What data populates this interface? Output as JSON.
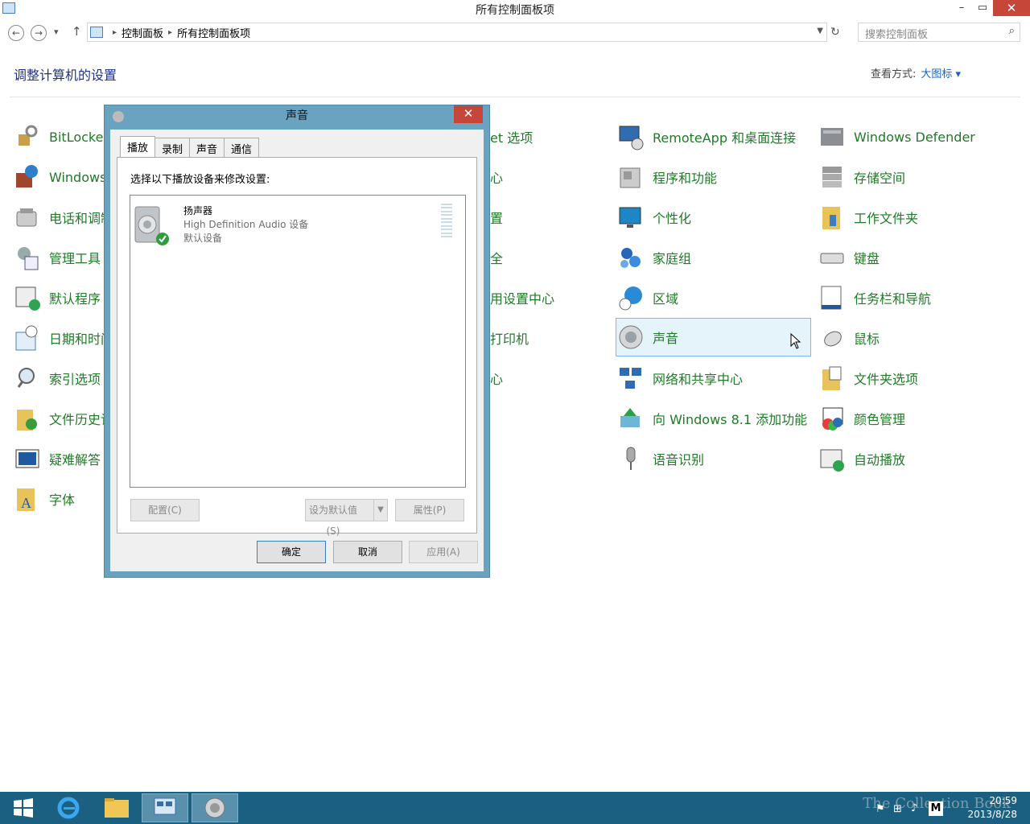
{
  "window": {
    "title": "所有控制面板项",
    "minimize": "–",
    "maximize": "▭",
    "close": "✕"
  },
  "nav": {
    "back": "←",
    "forward": "→",
    "recent": "▾",
    "up": "↑",
    "breadcrumb": [
      "控制面板",
      "所有控制面板项"
    ],
    "refresh": "↻",
    "search_placeholder": "搜索控制面板"
  },
  "header": {
    "title": "调整计算机的设置",
    "view_label": "查看方式:",
    "view_value": "大图标 ▾"
  },
  "items_col1": [
    "BitLocker",
    "Windows",
    "电话和调制",
    "管理工具",
    "默认程序",
    "日期和时间",
    "索引选项",
    "文件历史记",
    "疑难解答",
    "字体"
  ],
  "items_col2": [
    "et 选项",
    "心",
    "置",
    "全",
    "用设置中心",
    "打印机",
    "心"
  ],
  "items_col3": [
    "RemoteApp 和桌面连接",
    "程序和功能",
    "个性化",
    "家庭组",
    "区域",
    "声音",
    "网络和共享中心",
    "向 Windows 8.1 添加功能",
    "语音识别"
  ],
  "items_col4": [
    "Windows Defender",
    "存储空间",
    "工作文件夹",
    "键盘",
    "任务栏和导航",
    "鼠标",
    "文件夹选项",
    "颜色管理",
    "自动播放"
  ],
  "dialog": {
    "title": "声音",
    "close": "✕",
    "tabs": [
      "播放",
      "录制",
      "声音",
      "通信"
    ],
    "hint": "选择以下播放设备来修改设置:",
    "device": {
      "name": "扬声器",
      "description": "High Definition Audio 设备",
      "status": "默认设备"
    },
    "buttons": {
      "configure": "配置(C)",
      "set_default": "设为默认值(S)",
      "properties": "属性(P)",
      "ok": "确定",
      "cancel": "取消",
      "apply": "应用(A)"
    }
  },
  "taskbar": {
    "time": "20:59",
    "date": "2013/8/28",
    "watermark": "The Collection Book"
  },
  "colors": {
    "link_green": "#1e7b26",
    "heading_blue": "#1e3287",
    "taskbar": "#1c6081",
    "dialog_frame": "#6aa3bf",
    "close_red": "#c7463a"
  }
}
